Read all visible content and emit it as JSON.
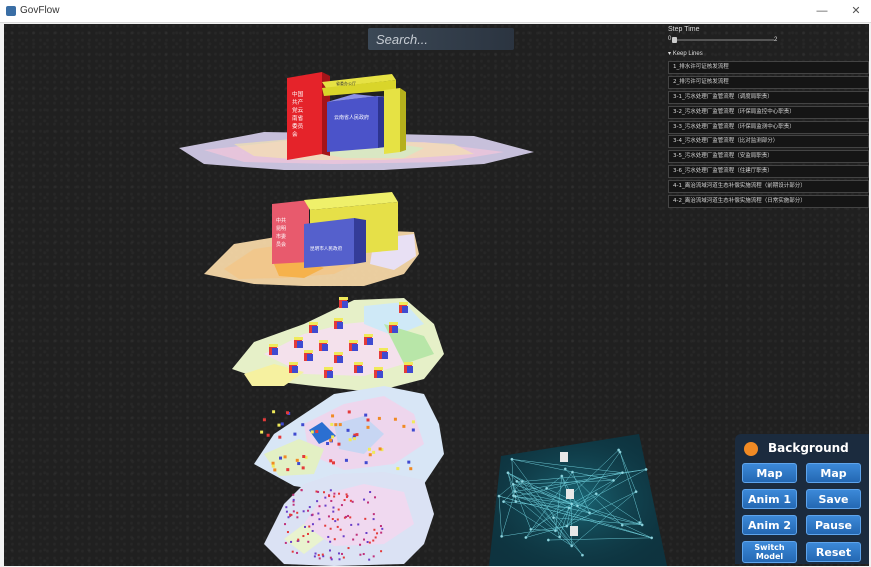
{
  "window": {
    "title": "GovFlow",
    "minimize": "—",
    "close": "✕"
  },
  "search": {
    "placeholder": "Search..."
  },
  "step_time": {
    "label": "Step Time",
    "min": "0",
    "max": "2",
    "value": 0
  },
  "keep_lines": {
    "label": "Keep Lines",
    "marker": "▾"
  },
  "lines": [
    "1_排水许可证核发流程",
    "2_排污许可证核发流程",
    "3-1_污水处理厂监管流程（调度局职责）",
    "3-2_污水处理厂监管流程（环保局监控中心职责）",
    "3-3_污水处理厂监管流程（环保局监测中心职责）",
    "3-4_污水处理厂监管流程（比对监测部分）",
    "3-5_污水处理厂监管流程（安监局职责）",
    "3-6_污水处理厂监管流程（住建厅职责）",
    "4-1_离治流域河道生态补偿实施流程（前期设计部分）",
    "4-2_离治流域河道生态补偿实施流程（日常实施部分）"
  ],
  "scene_labels": {
    "red_block_top": "中国共产党云南省委员会",
    "blue_block_top": "云南省人民政府",
    "yellow_block_top": "省委办公厅",
    "red_block_mid": "中共昆明市委员会",
    "blue_block_mid": "昆明市人民政府"
  },
  "controls": {
    "background": "Background",
    "map_left": "Map",
    "map_right": "Map",
    "anim1": "Anim 1",
    "save": "Save",
    "anim2": "Anim 2",
    "pause": "Pause",
    "switch_line1": "Switch",
    "switch_line2": "Model",
    "reset": "Reset"
  },
  "colors": {
    "panel": "#1b2b3e",
    "button": "#2f78c6",
    "accent_orange": "#f08a24",
    "scene_bg": "#202020"
  }
}
